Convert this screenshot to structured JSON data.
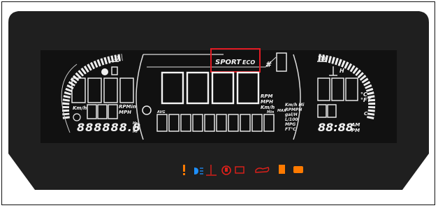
{
  "colors": {
    "bezel": "#1f1f1f",
    "lcd": "#111111",
    "lcd_segment": "#f4f4f4",
    "highlight_box": "#e31b23",
    "warning_orange": "#ff7a00",
    "indicator_blue": "#1e90ff",
    "indicator_red": "#e0201a"
  },
  "modes": {
    "sport": "SPORT",
    "eco": "ECO"
  },
  "left_panel": {
    "odometer": "888888.8",
    "speed_unit": "Km/h",
    "rpm_units": [
      "RPMin",
      "MPH"
    ],
    "odo_units": [
      "Hr",
      "Km",
      "Mi"
    ]
  },
  "center_panel": {
    "speed_digits": "8888",
    "units": [
      "RPM",
      "MPH",
      "Km/h"
    ],
    "avg_label": "AVG",
    "min_max": [
      "Min",
      "MAX"
    ],
    "right_units": [
      "Km/h Mi",
      "RPMPH",
      "gal/H",
      "L/100",
      "MPG",
      "FT°C"
    ]
  },
  "right_panel": {
    "temp_units": [
      "°C",
      "°FT"
    ],
    "clock": "88:88",
    "ampm": [
      "AM",
      "PM"
    ],
    "h_label": "H",
    "c_label": "C"
  },
  "indicator_icons": [
    "exclamation-icon",
    "headlight-icon",
    "coolant-temp-icon",
    "brake-icon",
    "battery-icon",
    "oil-pressure-icon",
    "fuel-icon",
    "engine-icon"
  ]
}
